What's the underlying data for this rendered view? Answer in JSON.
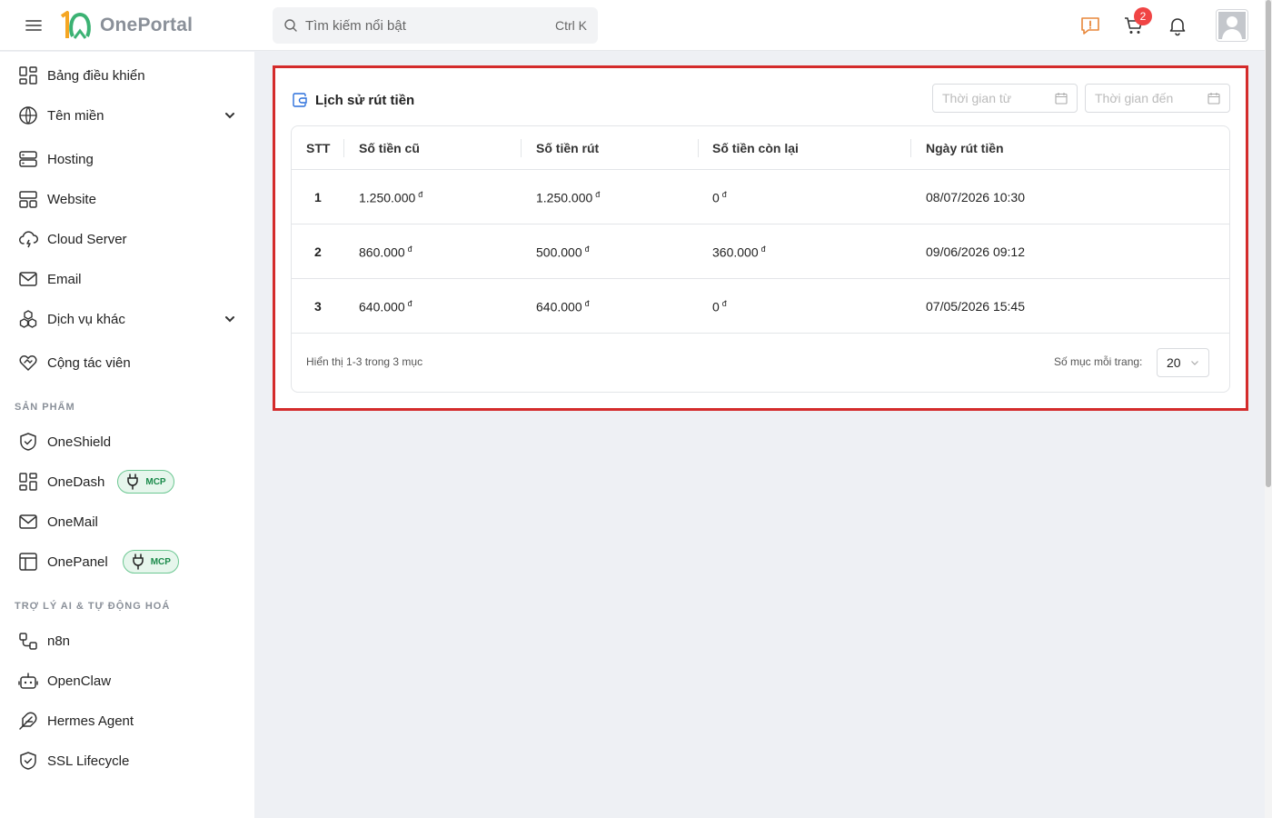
{
  "app": {
    "brand": "OnePortal"
  },
  "search": {
    "placeholder": "Tìm kiếm nổi bật",
    "shortcut": "Ctrl K"
  },
  "header": {
    "cart_count": "2"
  },
  "sidebar": {
    "items": [
      {
        "label": "Bảng điều khiển",
        "icon": "dashboard-icon"
      },
      {
        "label": "Tên miền",
        "icon": "globe-icon",
        "expandable": true
      },
      {
        "label": "Hosting",
        "icon": "server-icon"
      },
      {
        "label": "Website",
        "icon": "website-icon"
      },
      {
        "label": "Cloud Server",
        "icon": "cloud-icon"
      },
      {
        "label": "Email",
        "icon": "mail-icon"
      },
      {
        "label": "Dịch vụ khác",
        "icon": "boxes-icon",
        "expandable": true
      },
      {
        "label": "Cộng tác viên",
        "icon": "handshake-icon"
      }
    ],
    "products_title": "SẢN PHẨM",
    "products": [
      {
        "label": "OneShield",
        "icon": "shield-icon"
      },
      {
        "label": "OneDash",
        "icon": "dashboard-icon",
        "badge": "MCP"
      },
      {
        "label": "OneMail",
        "icon": "mail-icon"
      },
      {
        "label": "OnePanel",
        "icon": "panel-icon",
        "badge": "MCP"
      }
    ],
    "ai_title": "TRỢ LÝ AI & TỰ ĐỘNG HOÁ",
    "ai": [
      {
        "label": "n8n",
        "icon": "workflow-icon"
      },
      {
        "label": "OpenClaw",
        "icon": "bot-icon"
      },
      {
        "label": "Hermes Agent",
        "icon": "feather-icon"
      },
      {
        "label": "SSL Lifecycle",
        "icon": "shield-check-icon"
      }
    ]
  },
  "panel": {
    "title": "Lịch sử rút tiền",
    "date_from_placeholder": "Thời gian từ",
    "date_to_placeholder": "Thời gian đến",
    "columns": [
      "STT",
      "Số tiền cũ",
      "Số tiền rút",
      "Số tiền còn lại",
      "Ngày rút tiền"
    ],
    "currency": "đ",
    "rows": [
      {
        "stt": "1",
        "old": "1.250.000",
        "withdraw": "1.250.000",
        "remaining": "0",
        "date": "08/07/2026 10:30"
      },
      {
        "stt": "2",
        "old": "860.000",
        "withdraw": "500.000",
        "remaining": "360.000",
        "date": "09/06/2026 09:12"
      },
      {
        "stt": "3",
        "old": "640.000",
        "withdraw": "640.000",
        "remaining": "0",
        "date": "07/05/2026 15:45"
      }
    ],
    "footer_summary": "Hiển thị 1-3 trong 3 mục",
    "per_page_label": "Số mục mỗi trang:",
    "per_page_value": "20"
  },
  "colors": {
    "accent": "#2a6fdb",
    "highlight_border": "#d42b2b",
    "brand_green": "#3bb273",
    "brand_orange": "#f5a623"
  }
}
